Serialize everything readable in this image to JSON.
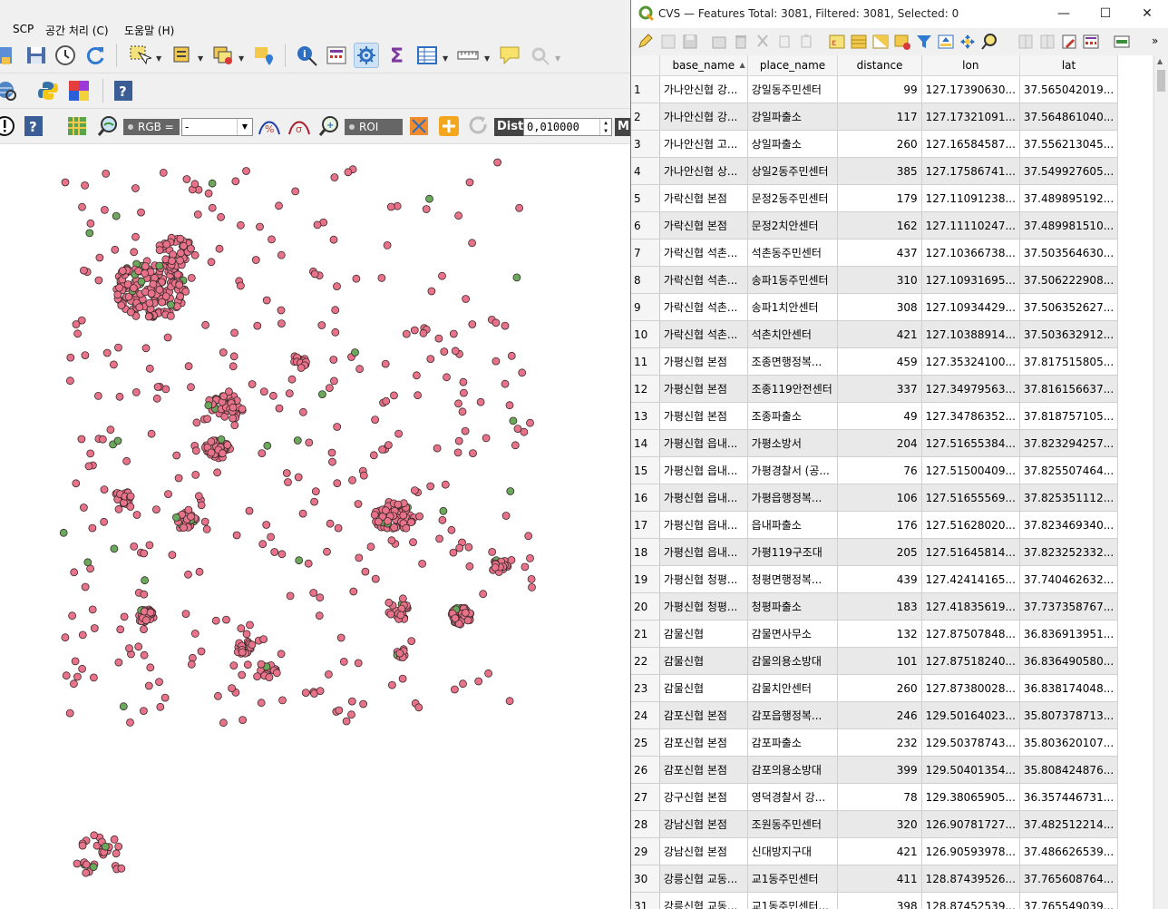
{
  "main": {
    "menu": [
      "SCP",
      "공간 처리 (C)",
      "도움말 (H)"
    ],
    "scp_toolbar": {
      "rgb_label": "RGB =",
      "rgb_value": "-",
      "roi_label": "ROI",
      "dist_label": "Dist",
      "dist_value": "0,010000",
      "m_label": "M"
    },
    "map": {
      "point_fill": "#e8728a",
      "point_alt_fill": "#6aa85c",
      "point_stroke": "#3a2a2a"
    }
  },
  "attribute_window": {
    "title": "CVS — Features Total: 3081, Filtered: 3081, Selected: 0",
    "window_buttons": {
      "minimize": "—",
      "maximize": "☐",
      "close": "✕"
    },
    "overflow": "»",
    "columns": [
      "base_name",
      "place_name",
      "distance",
      "lon",
      "lat"
    ],
    "sort_column": "base_name",
    "rows": [
      {
        "n": "1",
        "base_name": "가나안신협 강...",
        "place_name": "강일동주민센터",
        "distance": "99",
        "lon": "127.17390630...",
        "lat": "37.565042019..."
      },
      {
        "n": "2",
        "base_name": "가나안신협 강...",
        "place_name": "강일파출소",
        "distance": "117",
        "lon": "127.17321091...",
        "lat": "37.564861040..."
      },
      {
        "n": "3",
        "base_name": "가나안신협 고...",
        "place_name": "상일파출소",
        "distance": "260",
        "lon": "127.16584587...",
        "lat": "37.556213045..."
      },
      {
        "n": "4",
        "base_name": "가나안신협 상...",
        "place_name": "상일2동주민센터",
        "distance": "385",
        "lon": "127.17586741...",
        "lat": "37.549927605..."
      },
      {
        "n": "5",
        "base_name": "가락신협 본점",
        "place_name": "문정2동주민센터",
        "distance": "179",
        "lon": "127.11091238...",
        "lat": "37.489895192..."
      },
      {
        "n": "6",
        "base_name": "가락신협 본점",
        "place_name": "문정2치안센터",
        "distance": "162",
        "lon": "127.11110247...",
        "lat": "37.489981510..."
      },
      {
        "n": "7",
        "base_name": "가락신협 석촌...",
        "place_name": "석촌동주민센터",
        "distance": "437",
        "lon": "127.10366738...",
        "lat": "37.503564630..."
      },
      {
        "n": "8",
        "base_name": "가락신협 석촌...",
        "place_name": "송파1동주민센터",
        "distance": "310",
        "lon": "127.10931695...",
        "lat": "37.506222908..."
      },
      {
        "n": "9",
        "base_name": "가락신협 석촌...",
        "place_name": "송파1치안센터",
        "distance": "308",
        "lon": "127.10934429...",
        "lat": "37.506352627..."
      },
      {
        "n": "10",
        "base_name": "가락신협 석촌...",
        "place_name": "석촌치안센터",
        "distance": "421",
        "lon": "127.10388914...",
        "lat": "37.503632912..."
      },
      {
        "n": "11",
        "base_name": "가평신협 본점",
        "place_name": "조종면행정복...",
        "distance": "459",
        "lon": "127.35324100...",
        "lat": "37.817515805..."
      },
      {
        "n": "12",
        "base_name": "가평신협 본점",
        "place_name": "조종119안전센터",
        "distance": "337",
        "lon": "127.34979563...",
        "lat": "37.816156637..."
      },
      {
        "n": "13",
        "base_name": "가평신협 본점",
        "place_name": "조종파출소",
        "distance": "49",
        "lon": "127.34786352...",
        "lat": "37.818757105..."
      },
      {
        "n": "14",
        "base_name": "가평신협 읍내...",
        "place_name": "가평소방서",
        "distance": "204",
        "lon": "127.51655384...",
        "lat": "37.823294257..."
      },
      {
        "n": "15",
        "base_name": "가평신협 읍내...",
        "place_name": "가평경찰서 (공...",
        "distance": "76",
        "lon": "127.51500409...",
        "lat": "37.825507464..."
      },
      {
        "n": "16",
        "base_name": "가평신협 읍내...",
        "place_name": "가평읍행정복...",
        "distance": "106",
        "lon": "127.51655569...",
        "lat": "37.825351112..."
      },
      {
        "n": "17",
        "base_name": "가평신협 읍내...",
        "place_name": "읍내파출소",
        "distance": "176",
        "lon": "127.51628020...",
        "lat": "37.823469340..."
      },
      {
        "n": "18",
        "base_name": "가평신협 읍내...",
        "place_name": "가평119구조대",
        "distance": "205",
        "lon": "127.51645814...",
        "lat": "37.823252332..."
      },
      {
        "n": "19",
        "base_name": "가평신협 청평...",
        "place_name": "청평면행정복...",
        "distance": "439",
        "lon": "127.42414165...",
        "lat": "37.740462632..."
      },
      {
        "n": "20",
        "base_name": "가평신협 청평...",
        "place_name": "청평파출소",
        "distance": "183",
        "lon": "127.41835619...",
        "lat": "37.737358767..."
      },
      {
        "n": "21",
        "base_name": "감물신협",
        "place_name": "감물면사무소",
        "distance": "132",
        "lon": "127.87507848...",
        "lat": "36.836913951..."
      },
      {
        "n": "22",
        "base_name": "감물신협",
        "place_name": "감물의용소방대",
        "distance": "101",
        "lon": "127.87518240...",
        "lat": "36.836490580..."
      },
      {
        "n": "23",
        "base_name": "감물신협",
        "place_name": "감물치안센터",
        "distance": "260",
        "lon": "127.87380028...",
        "lat": "36.838174048..."
      },
      {
        "n": "24",
        "base_name": "감포신협 본점",
        "place_name": "감포읍행정복...",
        "distance": "246",
        "lon": "129.50164023...",
        "lat": "35.807378713..."
      },
      {
        "n": "25",
        "base_name": "감포신협 본점",
        "place_name": "감포파출소",
        "distance": "232",
        "lon": "129.50378743...",
        "lat": "35.803620107..."
      },
      {
        "n": "26",
        "base_name": "감포신협 본점",
        "place_name": "감포의용소방대",
        "distance": "399",
        "lon": "129.50401354...",
        "lat": "35.808424876..."
      },
      {
        "n": "27",
        "base_name": "강구신협 본점",
        "place_name": "영덕경찰서 강...",
        "distance": "78",
        "lon": "129.38065905...",
        "lat": "36.357446731..."
      },
      {
        "n": "28",
        "base_name": "강남신협 본점",
        "place_name": "조원동주민센터",
        "distance": "320",
        "lon": "126.90781727...",
        "lat": "37.482512214..."
      },
      {
        "n": "29",
        "base_name": "강남신협 본점",
        "place_name": "신대방지구대",
        "distance": "421",
        "lon": "126.90593978...",
        "lat": "37.486626539..."
      },
      {
        "n": "30",
        "base_name": "강릉신협 교동...",
        "place_name": "교1동주민센터",
        "distance": "411",
        "lon": "128.87439526...",
        "lat": "37.765608764..."
      },
      {
        "n": "31",
        "base_name": "강릉신협 교동...",
        "place_name": "교1동주민센터...",
        "distance": "398",
        "lon": "128.87452539...",
        "lat": "37.765549039..."
      }
    ]
  }
}
